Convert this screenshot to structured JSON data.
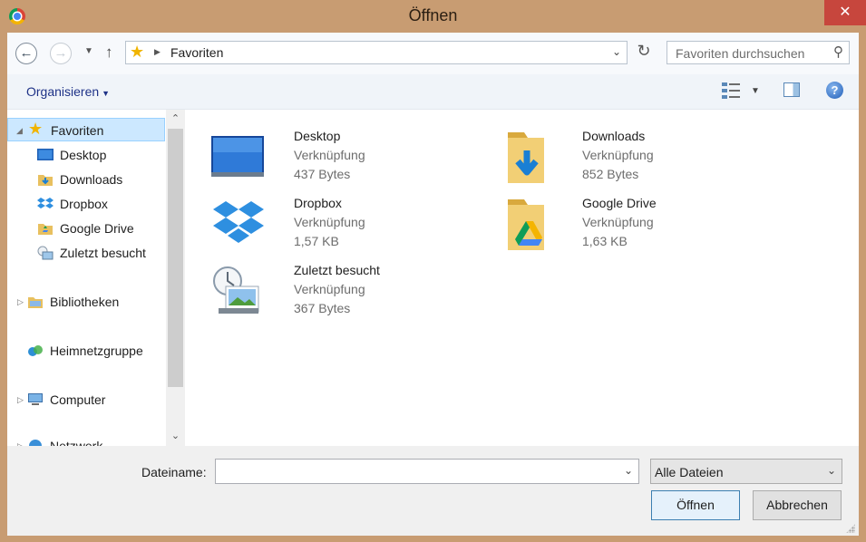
{
  "window": {
    "title": "Öffnen",
    "close_label": "✕"
  },
  "address_bar": {
    "location": "Favoriten",
    "search_placeholder": "Favoriten durchsuchen"
  },
  "toolbar": {
    "organise_label": "Organisieren"
  },
  "nav_pane": {
    "items": [
      {
        "label": "Favoriten",
        "icon": "star-icon",
        "selected": true
      },
      {
        "label": "Desktop",
        "icon": "desktop-icon"
      },
      {
        "label": "Downloads",
        "icon": "downloads-folder-icon"
      },
      {
        "label": "Dropbox",
        "icon": "dropbox-icon"
      },
      {
        "label": "Google Drive",
        "icon": "google-drive-folder-icon"
      },
      {
        "label": "Zuletzt besucht",
        "icon": "recent-places-icon"
      },
      {
        "label": "Bibliotheken",
        "icon": "libraries-icon"
      },
      {
        "label": "Heimnetzgruppe",
        "icon": "homegroup-icon"
      },
      {
        "label": "Computer",
        "icon": "computer-icon"
      },
      {
        "label": "Netzwerk",
        "icon": "network-icon"
      }
    ]
  },
  "files": [
    {
      "name": "Desktop",
      "type": "Verknüpfung",
      "size": "437 Bytes",
      "icon": "desktop-icon"
    },
    {
      "name": "Downloads",
      "type": "Verknüpfung",
      "size": "852 Bytes",
      "icon": "downloads-folder-icon"
    },
    {
      "name": "Dropbox",
      "type": "Verknüpfung",
      "size": "1,57 KB",
      "icon": "dropbox-icon"
    },
    {
      "name": "Google Drive",
      "type": "Verknüpfung",
      "size": "1,63 KB",
      "icon": "google-drive-folder-icon"
    },
    {
      "name": "Zuletzt besucht",
      "type": "Verknüpfung",
      "size": "367 Bytes",
      "icon": "recent-places-icon"
    }
  ],
  "bottom": {
    "filename_label": "Dateiname:",
    "filename_value": "",
    "filter_value": "Alle Dateien",
    "open_label": "Öffnen",
    "cancel_label": "Abbrechen"
  }
}
